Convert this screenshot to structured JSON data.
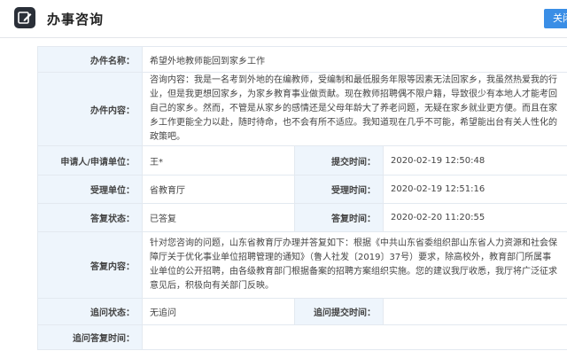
{
  "header": {
    "title": "办事咨询",
    "close_label": "关闭"
  },
  "form": {
    "subject_label": "办件名称：",
    "subject": "希望外地教师能回到家乡工作",
    "content_label": "办件内容：",
    "content": "咨询内容：我是一名考到外地的在编教师，受编制和最低服务年限等因素无法回家乡，我虽然热爱我的行业，但是我更想回家乡，为家乡教育事业做贡献。现在教师招聘偶不限户籍，导致很少有本地人才能考回自己的家乡。然而，不管是从家乡的感情还是父母年龄大了养老问题，无疑在家乡就业更方便。而且在家乡工作更能全力以赴，随时待命，也不会有所不适应。我知道现在几乎不可能，希望能出台有关人性化的政策吧。",
    "applicant_label": "申请人/申请单位：",
    "applicant": "王*",
    "submit_time_label": "提交时间：",
    "submit_time": "2020-02-19 12:50:48",
    "accept_unit_label": "受理单位：",
    "accept_unit": "省教育厅",
    "accept_time_label": "受理时间：",
    "accept_time": "2020-02-19 12:51:16",
    "reply_status_label": "答复状态：",
    "reply_status": "已答复",
    "reply_time_label": "答复时间：",
    "reply_time": "2020-02-20 11:20:55",
    "reply_content_label": "答复内容：",
    "reply_content": "针对您咨询的问题，山东省教育厅办理并答复如下：根据《中共山东省委组织部山东省人力资源和社会保障厅关于优化事业单位招聘管理的通知》（鲁人社发〔2019〕37号）要求，除高校外，教育部门所属事业单位的公开招聘，由各级教育部门根据备案的招聘方案组织实施。您的建议我厅收悉，我厅将广泛征求意见后，积极向有关部门反映。",
    "followup_status_label": "追问状态：",
    "followup_status": "无追问",
    "followup_submit_time_label": "追问提交时间：",
    "followup_submit_time": "",
    "followup_reply_time_label": "追问答复时间：",
    "followup_reply_time": ""
  }
}
